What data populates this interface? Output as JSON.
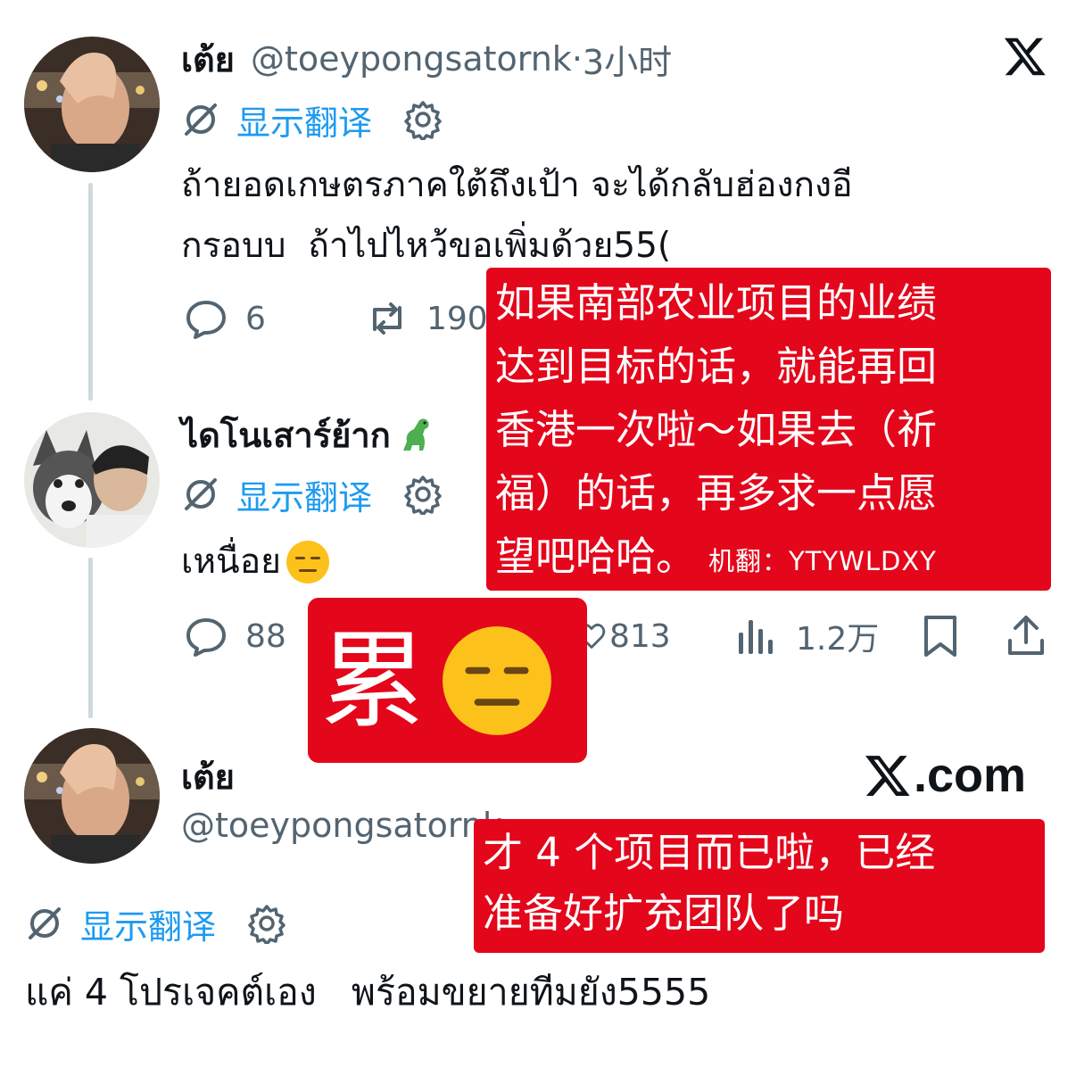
{
  "tweet1": {
    "name": "เต้ย",
    "handle": "@toeypongsatornk",
    "separator": "·",
    "time": "3小时",
    "translate_label": "显示翻译",
    "text_line1": "ถ้ายอดเกษตรภาคใต้ถึงเป้า จะได้กลับฮ่องกงอี",
    "text_line2": "กรอบบ  ถ้าไปไหว้ขอเพิ่มด้วย55(",
    "reply_count": "6",
    "repost_count": "190"
  },
  "tweet2": {
    "name": "ไดโนเสาร์ย้าก",
    "name_emoji": "dinosaur-emoji",
    "translate_label": "显示翻译",
    "text": "เหนื่อย",
    "text_emoji": "expressionless-face-emoji",
    "reply_count": "88",
    "like_count": "813",
    "view_count": "1.2万"
  },
  "tweet3": {
    "name": "เต้ย",
    "handle": "@toeypongsatornk",
    "translate_label": "显示翻译",
    "text": "แค่ 4 โปรเจคต์เอง   พร้อมขยายทีมยัง5555"
  },
  "branding": {
    "x_logo": "x-logo-icon",
    "site": "X.com",
    "site_rest": ".com"
  },
  "overlays": {
    "translation1": "如果南部农业项目的业绩\n达到目标的话，就能再回\n香港一次啦～如果去（祈\n福）的话，再多求一点愿",
    "translation1_last": "望吧哈哈。",
    "machine_translation_label": "机翻：YTYWLDXY",
    "translation2_char": "累",
    "translation3": "才 4 个项目而已啦，已经\n准备好扩充团队了吗"
  },
  "colors": {
    "accent": "#1d9bf0",
    "muted": "#536471",
    "overlay_red": "#e4061b"
  }
}
